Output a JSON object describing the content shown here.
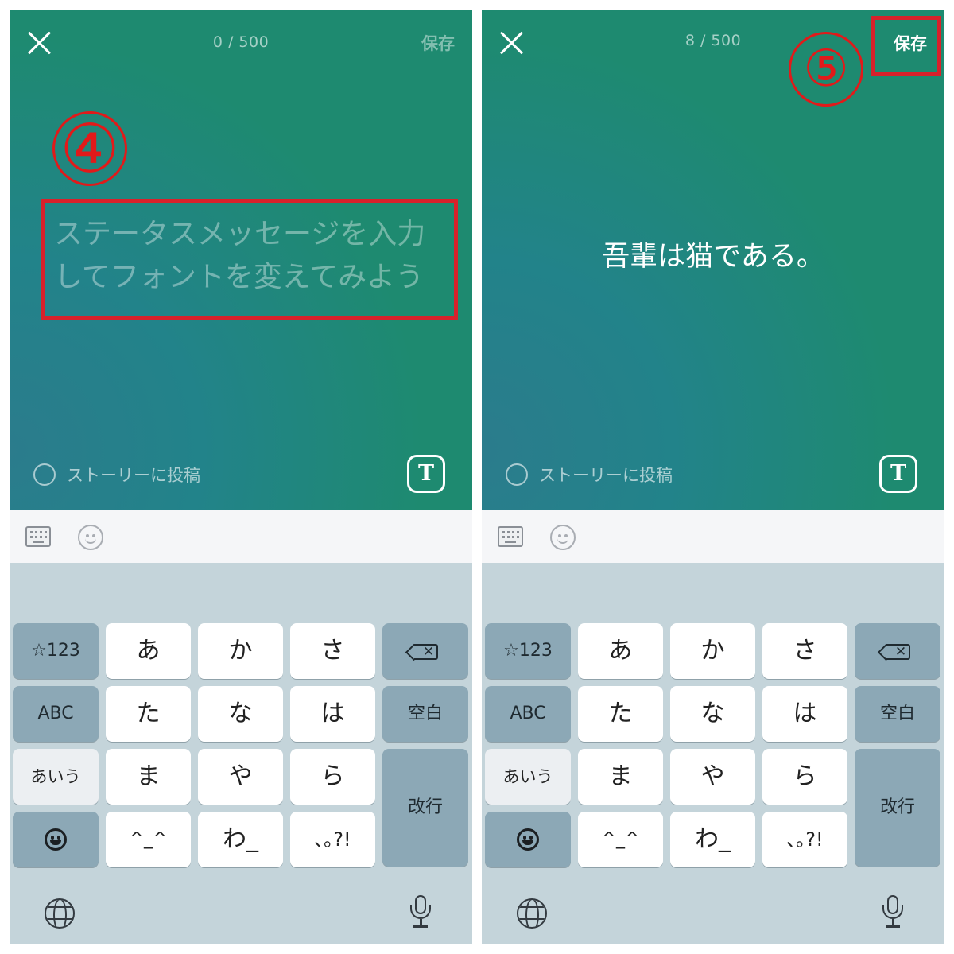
{
  "screen_left": {
    "counter": "0 / 500",
    "save_label": "保存",
    "placeholder": "ステータスメッセージを入力してフォントを変えてみよう",
    "step_number": "④",
    "story_label": "ストーリーに投稿",
    "font_button": "T"
  },
  "screen_right": {
    "counter": "8 / 500",
    "save_label": "保存",
    "status_text": "吾輩は猫である。",
    "step_number": "⑤",
    "story_label": "ストーリーに投稿",
    "font_button": "T"
  },
  "keyboard": {
    "keys": {
      "num": "☆123",
      "a": "あ",
      "ka": "か",
      "sa": "さ",
      "abc": "ABC",
      "ta": "た",
      "na": "な",
      "ha": "は",
      "space": "空白",
      "kana": "あいう",
      "ma": "ま",
      "ya": "や",
      "ra": "ら",
      "enter": "改行",
      "kaomoji": "^_^",
      "wa": "わ_",
      "punct": "､｡?!"
    }
  },
  "colors": {
    "accent_red": "#d8212b",
    "editor_green": "#1e8a70",
    "editor_teal": "#2b7c8c",
    "keyboard_bg": "#c4d4da",
    "function_key": "#8ca8b6"
  },
  "icons": [
    "close-icon",
    "keyboard-icon",
    "emoji-icon",
    "text-font-icon",
    "backspace-icon",
    "emoji-face-icon",
    "globe-icon",
    "microphone-icon"
  ]
}
